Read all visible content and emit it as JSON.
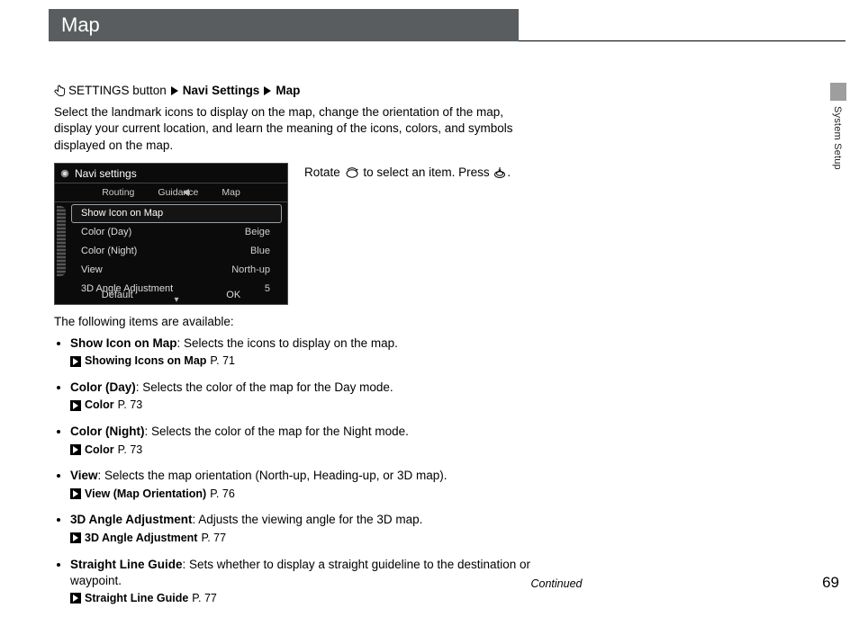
{
  "title": "Map",
  "breadcrumb": {
    "btn": "SETTINGS button",
    "step1": "Navi Settings",
    "step2": "Map"
  },
  "intro": "Select the landmark icons to display on the map, change the orientation of the map, display your current location, and learn the meaning of the icons, colors, and symbols displayed on the map.",
  "instruction": {
    "rotate": "Rotate",
    "mid": "to select an item. Press",
    "end": "."
  },
  "nav_shot": {
    "header": "Navi settings",
    "tabs": {
      "routing": "Routing",
      "guidance": "Guidance",
      "map": "Map"
    },
    "items": [
      {
        "label": "Show Icon on Map",
        "value": ""
      },
      {
        "label": "Color (Day)",
        "value": "Beige"
      },
      {
        "label": "Color (Night)",
        "value": "Blue"
      },
      {
        "label": "View",
        "value": "North-up"
      },
      {
        "label": "3D Angle Adjustment",
        "value": "5"
      }
    ],
    "buttons": {
      "default": "Default",
      "ok": "OK"
    }
  },
  "following": "The following items are available:",
  "bullets": [
    {
      "lead": "Show Icon on Map",
      "desc": ": Selects the icons to display on the map.",
      "xref": "Showing Icons on Map",
      "page": "P. 71"
    },
    {
      "lead": "Color (Day)",
      "desc": ": Selects the color of the map for the Day mode.",
      "xref": "Color",
      "page": "P. 73"
    },
    {
      "lead": "Color (Night)",
      "desc": ": Selects the color of the map for the Night mode.",
      "xref": "Color",
      "page": "P. 73"
    },
    {
      "lead": "View",
      "desc": ": Selects the map orientation (North-up, Heading-up, or 3D map).",
      "xref": "View (Map Orientation)",
      "page": "P. 76"
    },
    {
      "lead": "3D Angle Adjustment",
      "desc": ": Adjusts the viewing angle for the 3D map.",
      "xref": "3D Angle Adjustment",
      "page": "P. 77"
    },
    {
      "lead": "Straight Line Guide",
      "desc": ": Sets whether to display a straight guideline to the destination or waypoint.",
      "xref": "Straight Line Guide",
      "page": "P. 77"
    }
  ],
  "continued": "Continued",
  "page_number": "69",
  "side_tab": "System Setup"
}
